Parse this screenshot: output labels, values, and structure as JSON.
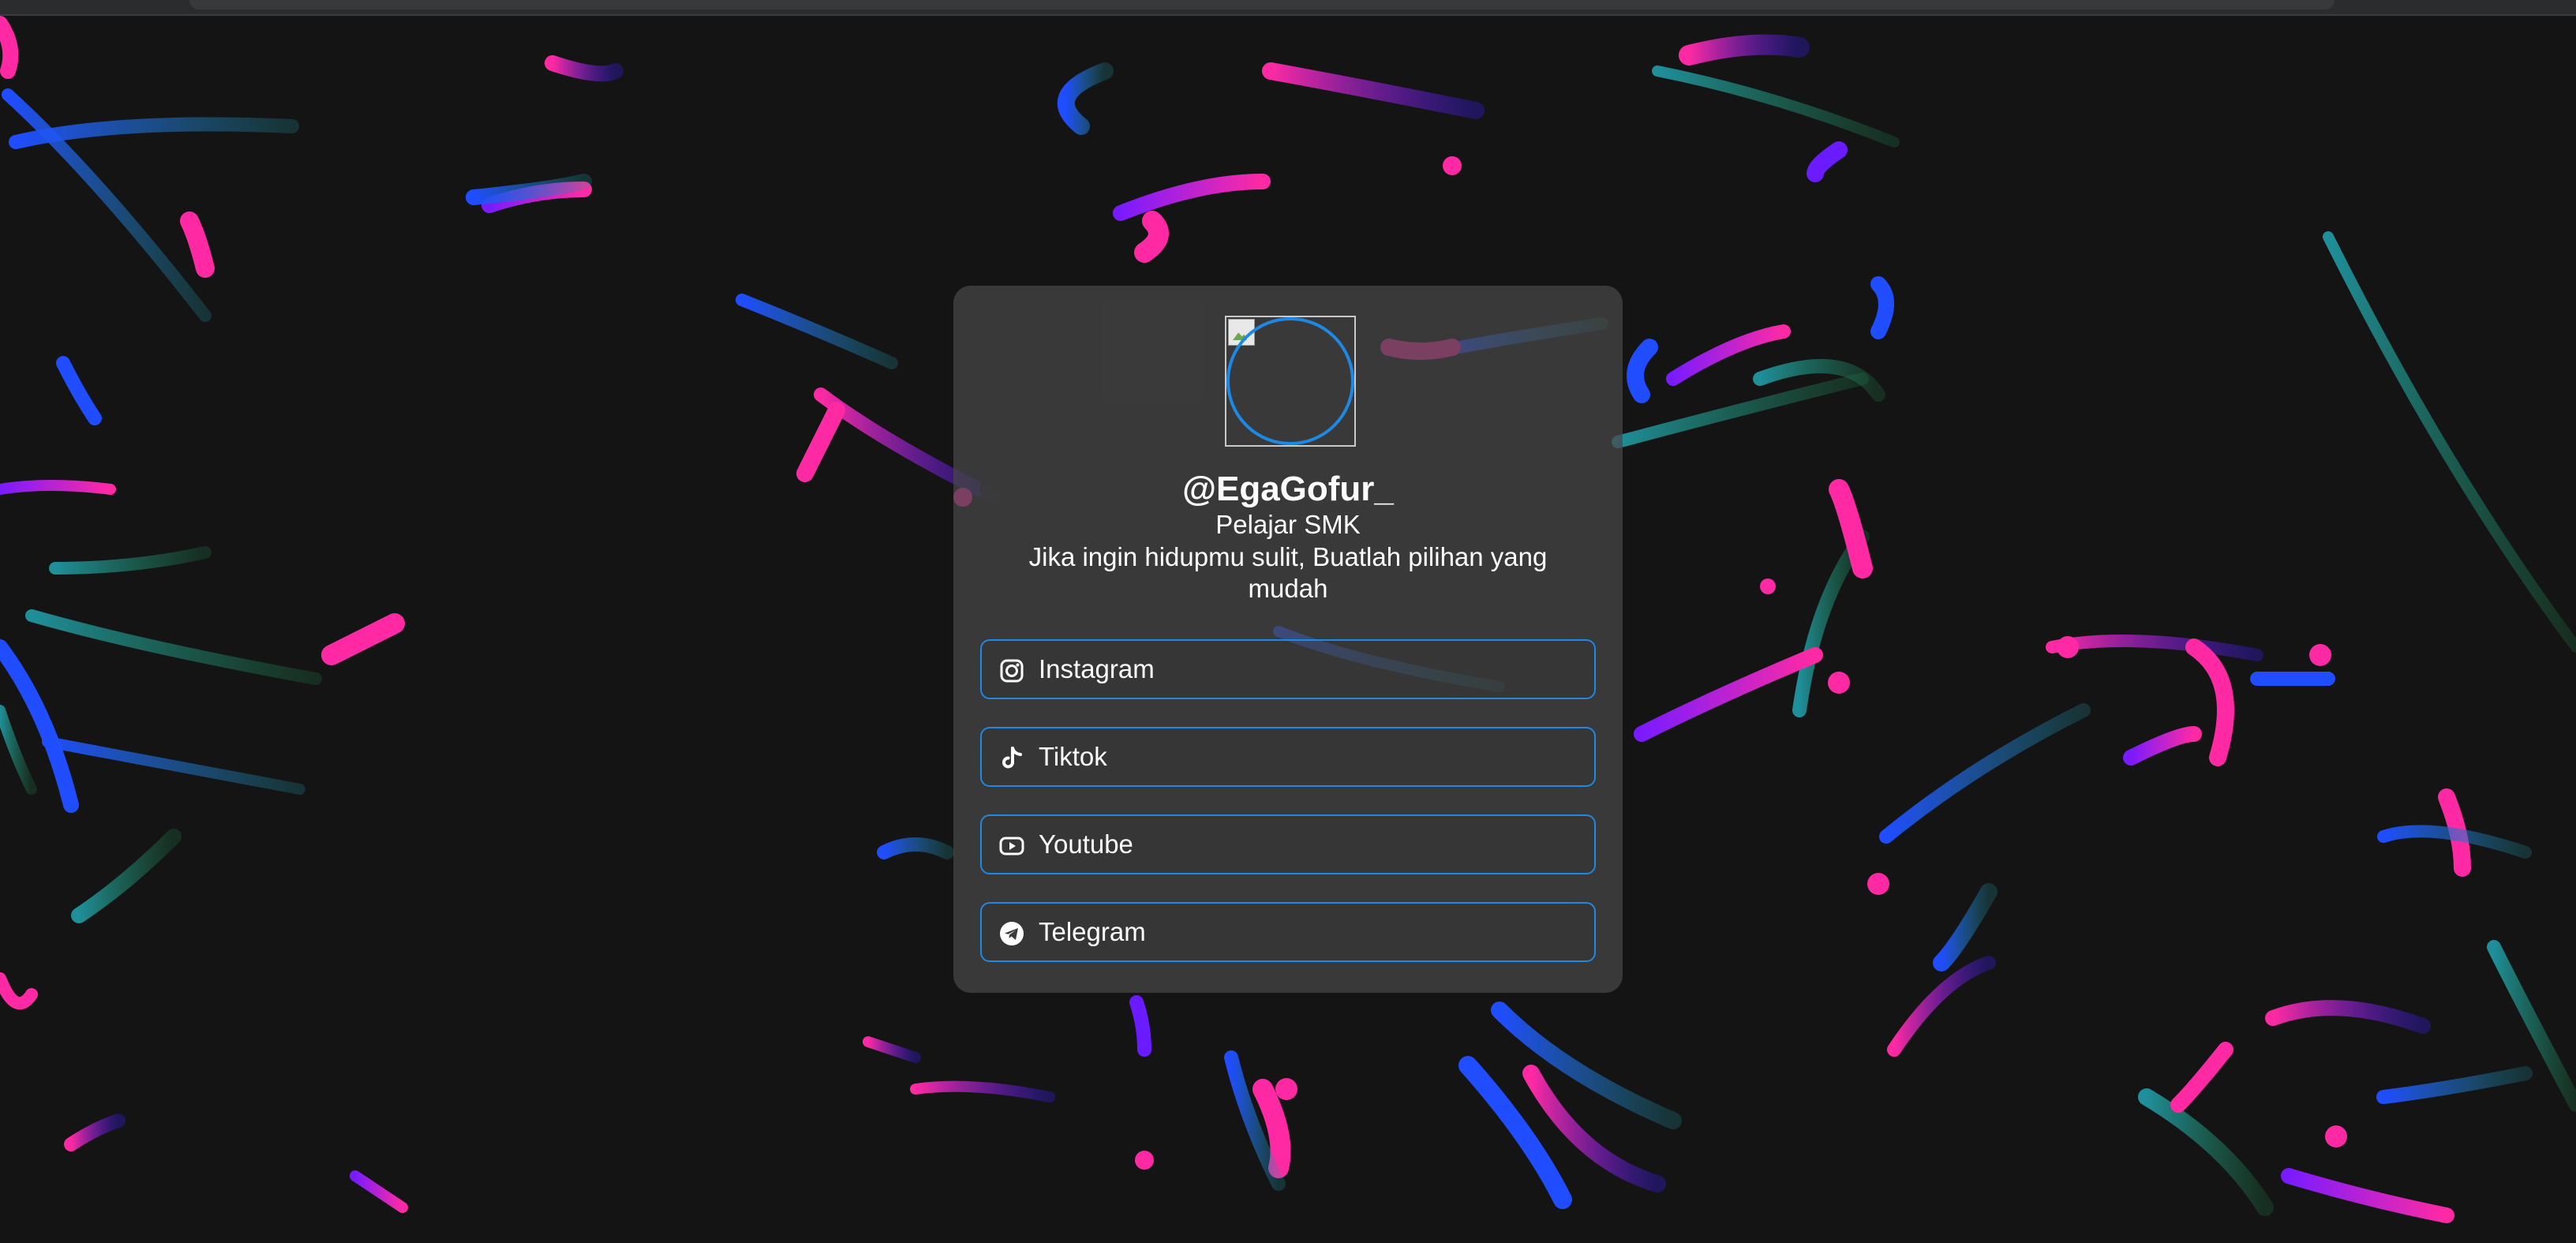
{
  "profile": {
    "username": "@EgaGofur_",
    "role": "Pelajar SMK",
    "bio": "Jika ingin hidupmu sulit, Buatlah pilihan yang mudah"
  },
  "links": [
    {
      "label": "Instagram",
      "icon": "instagram-icon"
    },
    {
      "label": "Tiktok",
      "icon": "tiktok-icon"
    },
    {
      "label": "Youtube",
      "icon": "youtube-icon"
    },
    {
      "label": "Telegram",
      "icon": "telegram-icon"
    }
  ],
  "colors": {
    "accent": "#1e88e5",
    "background": "#141414",
    "card": "#484848",
    "text": "#ffffff",
    "streak_pink": "#ff2aa3",
    "streak_purple": "#6a1bff",
    "streak_blue": "#1f4dff",
    "streak_teal": "#1f8f9a",
    "streak_green": "#1f7a4a"
  }
}
